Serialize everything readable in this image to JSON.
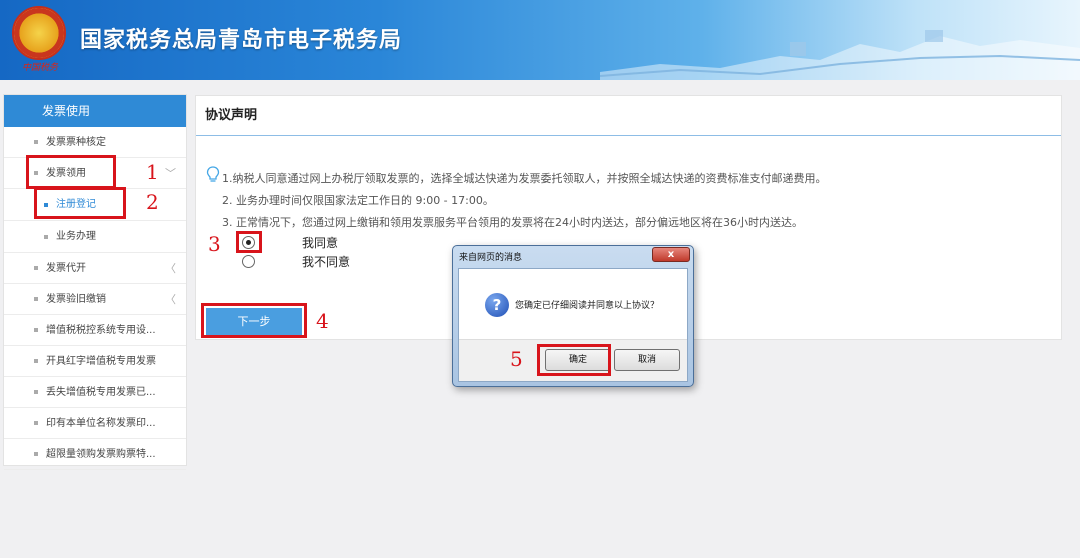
{
  "header": {
    "title": "国家税务总局青岛市电子税务局",
    "emblem_text": "中国税务",
    "icon": "tax-emblem-icon"
  },
  "sidebar": {
    "heading": "发票使用",
    "items": [
      {
        "label": "发票票种核定"
      },
      {
        "label": "发票领用",
        "chevron": "﹀"
      },
      {
        "label": "注册登记"
      },
      {
        "label": "业务办理"
      },
      {
        "label": "发票代开",
        "chevron": "〈"
      },
      {
        "label": "发票验旧缴销",
        "chevron": "〈"
      },
      {
        "label": "增值税税控系统专用设..."
      },
      {
        "label": "开具红字增值税专用发票"
      },
      {
        "label": "丢失增值税专用发票已..."
      },
      {
        "label": "印有本单位名称发票印..."
      },
      {
        "label": "超限量领购发票购票特..."
      }
    ]
  },
  "panel": {
    "title": "协议声明",
    "lines": [
      "1.纳税人同意通过网上办税厅领取发票的，选择全城达快递为发票委托领取人，并按照全城达快递的资费标准支付邮递费用。",
      "2. 业务办理时间仅限国家法定工作日的 9:00 - 17:00。",
      "3. 正常情况下，您通过网上缴销和领用发票服务平台领用的发票将在24小时内送达，部分偏远地区将在36小时内送达。"
    ],
    "agree_label": "我同意",
    "disagree_label": "我不同意",
    "next_label": "下一步"
  },
  "dialog": {
    "title": "来自网页的消息",
    "close_label": "x",
    "message": "您确定已仔细阅读并同意以上协议？",
    "ok_label": "确定",
    "cancel_label": "取消",
    "icon": "question-icon"
  },
  "annotations": [
    "1",
    "2",
    "3",
    "4",
    "5"
  ],
  "colors": {
    "accent": "#2f8ad6",
    "highlight": "#d8141b"
  }
}
